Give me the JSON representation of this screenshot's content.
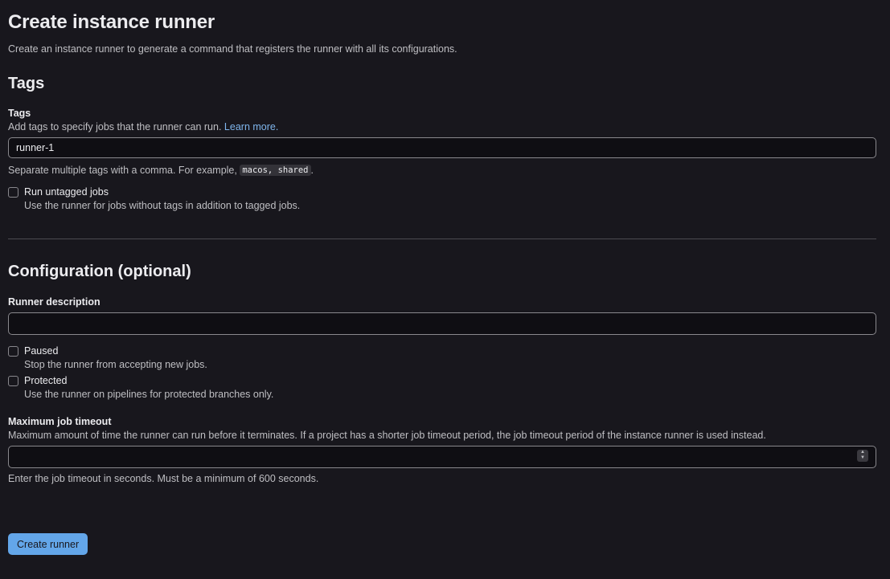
{
  "page": {
    "title": "Create instance runner",
    "description": "Create an instance runner to generate a command that registers the runner with all its configurations."
  },
  "tags_section": {
    "heading": "Tags",
    "field_label": "Tags",
    "field_description_prefix": "Add tags to specify jobs that the runner can run. ",
    "learn_more": "Learn more.",
    "input_value": "runner-1",
    "help_prefix": "Separate multiple tags with a comma. For example, ",
    "help_code": "macos, shared",
    "help_suffix": ".",
    "run_untagged": {
      "label": "Run untagged jobs",
      "help": "Use the runner for jobs without tags in addition to tagged jobs.",
      "checked": false
    }
  },
  "config_section": {
    "heading": "Configuration (optional)",
    "description_label": "Runner description",
    "description_value": "",
    "paused": {
      "label": "Paused",
      "help": "Stop the runner from accepting new jobs.",
      "checked": false
    },
    "protected": {
      "label": "Protected",
      "help": "Use the runner on pipelines for protected branches only.",
      "checked": false
    },
    "timeout_label": "Maximum job timeout",
    "timeout_description": "Maximum amount of time the runner can run before it terminates. If a project has a shorter job timeout period, the job timeout period of the instance runner is used instead.",
    "timeout_value": "",
    "timeout_help": "Enter the job timeout in seconds. Must be a minimum of 600 seconds."
  },
  "actions": {
    "submit_label": "Create runner"
  },
  "colors": {
    "background": "#18171d",
    "link": "#7fb6ed",
    "primary_button": "#63a6e9"
  }
}
